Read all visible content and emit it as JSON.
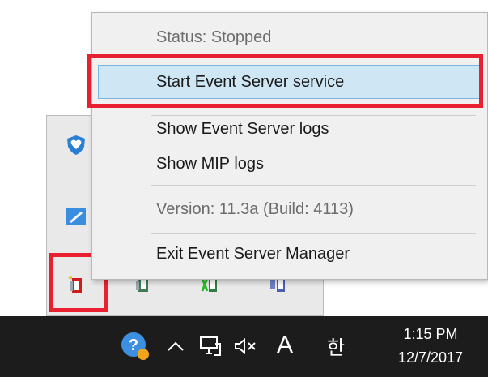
{
  "context_menu": {
    "items": [
      {
        "label": "Status: Stopped",
        "disabled": true
      },
      {
        "label": "Start Event Server service",
        "disabled": false,
        "highlighted": true
      },
      {
        "label": "Show Event Server logs",
        "disabled": false
      },
      {
        "label": "Show MIP logs",
        "disabled": false
      },
      {
        "label": "Version: 11.3a (Build: 4113)",
        "disabled": true
      },
      {
        "label": "Exit Event Server Manager",
        "disabled": false
      }
    ]
  },
  "tray_overflow": {
    "icons": [
      "shield-heart-icon",
      "snipping-tool-icon",
      "event-server-manager-icon",
      "recording-server-icon",
      "mobile-server-icon",
      "management-server-icon"
    ]
  },
  "taskbar": {
    "icons": [
      "help-badge-icon",
      "chevron-up-icon",
      "network-icon",
      "volume-muted-icon"
    ],
    "ime_label": "A",
    "ime_alt_label": "한",
    "clock_time": "1:15 PM",
    "clock_date": "12/7/2017"
  },
  "colors": {
    "highlight_red": "#e8202f",
    "menu_hover": "#cfe6f5",
    "taskbar_bg": "#1c1c1c"
  }
}
